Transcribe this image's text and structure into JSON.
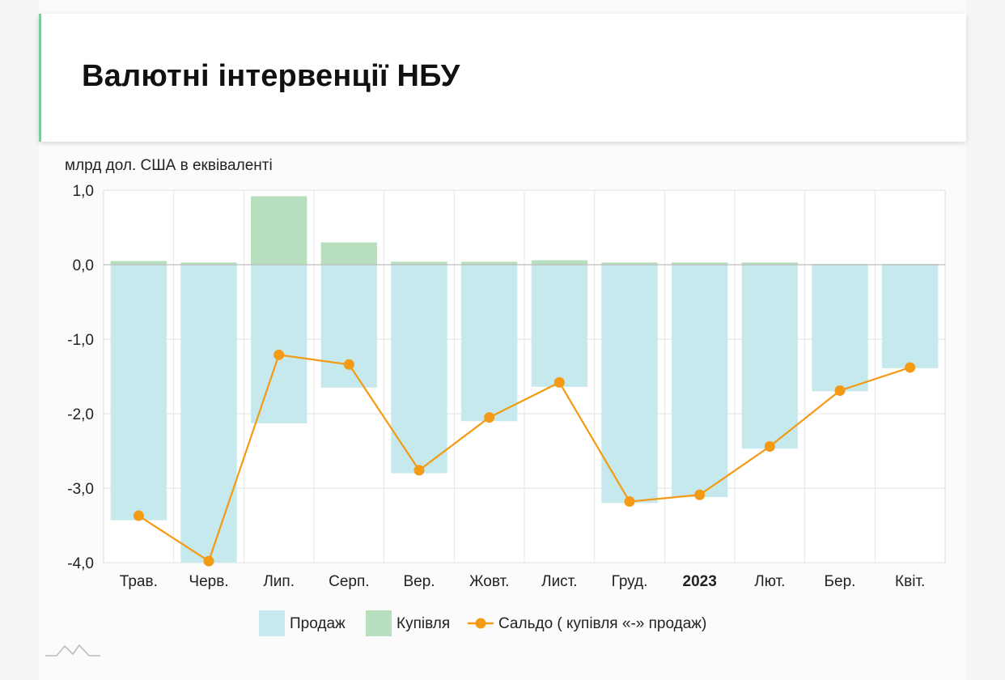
{
  "header": {
    "title": "Валютні інтервенції НБУ"
  },
  "chart_data": {
    "type": "bar",
    "unit_label": "млрд дол. США в еквіваленті",
    "categories": [
      "Трав.",
      "Черв.",
      "Лип.",
      "Серп.",
      "Вер.",
      "Жовт.",
      "Лист.",
      "Груд.",
      "2023",
      "Лют.",
      "Бер.",
      "Квіт."
    ],
    "bold_categories": [
      "2023"
    ],
    "ylim": [
      -4.0,
      1.0
    ],
    "yticks": [
      "1,0",
      "0,0",
      "-1,0",
      "-2,0",
      "-3,0",
      "-4,0"
    ],
    "grid": true,
    "legend_position": "bottom",
    "series": [
      {
        "name": "Продаж",
        "kind": "bar",
        "color": "#c5e9ec",
        "values": [
          -3.43,
          -4.0,
          -2.13,
          -1.65,
          -2.8,
          -2.1,
          -1.64,
          -3.2,
          -3.12,
          -2.47,
          -1.7,
          -1.39
        ]
      },
      {
        "name": "Купівля",
        "kind": "bar",
        "color": "#b7dfbd",
        "values": [
          0.05,
          0.03,
          0.92,
          0.3,
          0.04,
          0.04,
          0.06,
          0.03,
          0.03,
          0.03,
          0.01,
          0.01
        ]
      },
      {
        "name": "Сальдо ( купівля «-» продаж)",
        "kind": "line",
        "color": "#f59a14",
        "values": [
          -3.37,
          -3.98,
          -1.21,
          -1.34,
          -2.76,
          -2.05,
          -1.58,
          -3.18,
          -3.09,
          -2.44,
          -1.69,
          -1.38
        ]
      }
    ]
  }
}
